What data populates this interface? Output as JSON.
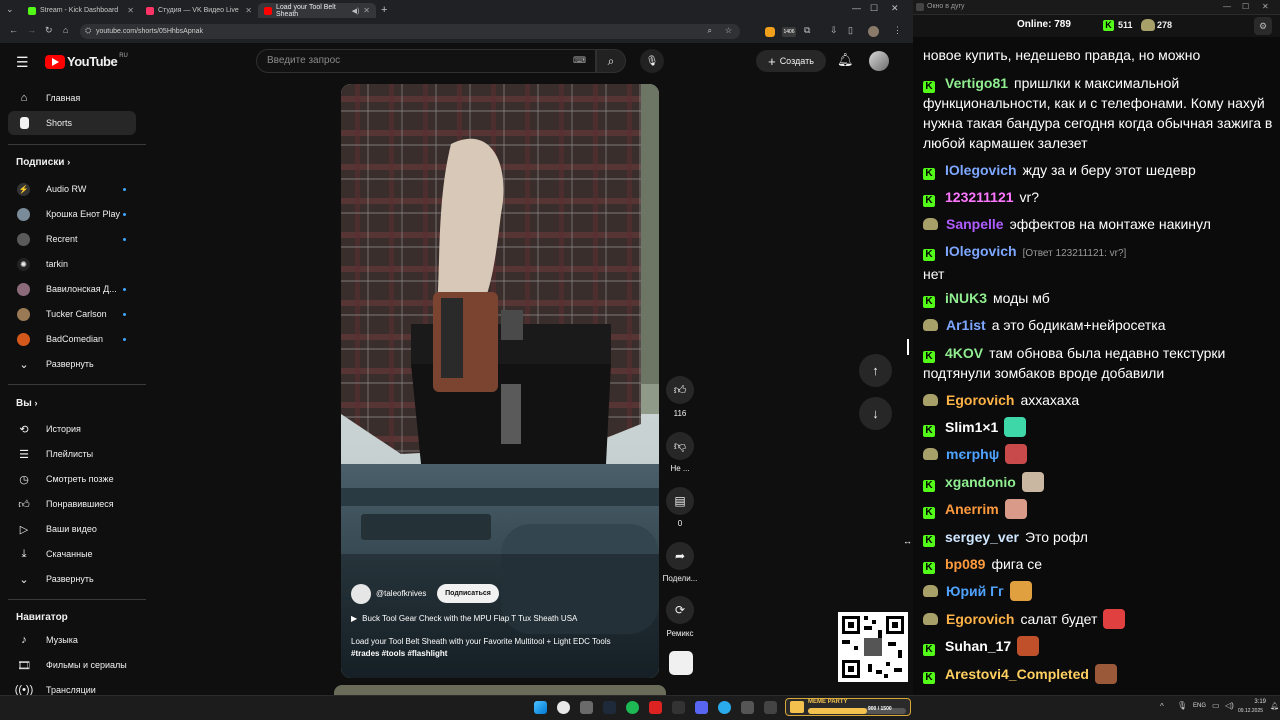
{
  "browser": {
    "tabs": [
      {
        "title": "Stream - Kick Dashboard",
        "color": "#53fc18"
      },
      {
        "title": "Студия — VK Видео Live",
        "color": "#ff3366"
      },
      {
        "title": "Load your Tool Belt Sheath",
        "color": "#ff0000"
      }
    ],
    "url": "youtube.com/shorts/05HhbsApnak"
  },
  "youtube": {
    "logo": "YouTube",
    "region": "RU",
    "search_placeholder": "Введите запрос",
    "create_label": "Создать",
    "nav": [
      {
        "label": "Главная",
        "icon": "home-icon"
      },
      {
        "label": "Shorts",
        "icon": "shorts-icon"
      }
    ],
    "subscriptions_title": "Подписки",
    "subscriptions": [
      {
        "label": "Audio RW",
        "color": "#444"
      },
      {
        "label": "Крошка Енот Play",
        "color": "#7a8b99"
      },
      {
        "label": "Recrent",
        "color": "#5a5a5a"
      },
      {
        "label": "tarkin",
        "color": "#333"
      },
      {
        "label": "Вавилонская Д...",
        "color": "#8b6a7a"
      },
      {
        "label": "Tucker Carlson",
        "color": "#9a7a55"
      },
      {
        "label": "BadComedian",
        "color": "#d4581c"
      }
    ],
    "expand_label": "Развернуть",
    "you_title": "Вы",
    "you_items": [
      {
        "label": "История",
        "icon": "history-icon"
      },
      {
        "label": "Плейлисты",
        "icon": "playlist-icon"
      },
      {
        "label": "Смотреть позже",
        "icon": "clock-icon"
      },
      {
        "label": "Понравившиеся",
        "icon": "thumb-up-icon"
      },
      {
        "label": "Ваши видео",
        "icon": "video-icon"
      },
      {
        "label": "Скачанные",
        "icon": "download-icon"
      }
    ],
    "expand_label2": "Развернуть",
    "navigator_title": "Навигатор",
    "navigator_items": [
      {
        "label": "Музыка",
        "icon": "music-icon"
      },
      {
        "label": "Фильмы и сериалы",
        "icon": "film-icon"
      },
      {
        "label": "Трансляции",
        "icon": "live-icon"
      }
    ],
    "short": {
      "channel": "@taleofknives",
      "subscribe_label": "Подписаться",
      "product_link": "Buck Tool Gear Check with the MPU Flap T Tux Sheath USA",
      "title": "Load your Tool Belt Sheath with your Favorite Multitool + Light EDC Tools",
      "hashtags": "#trades #tools #flashlight",
      "likes": "116",
      "dislike_label": "Не ...",
      "comments": "0",
      "share_label": "Подели...",
      "remix_label": "Ремикс"
    }
  },
  "chat": {
    "window_title": "Окно в дугу",
    "online_label": "Online:",
    "online_count": "789",
    "kick_count": "511",
    "other_count": "278",
    "top_partial": "новое купить, недешево правда, но можно",
    "messages": [
      {
        "badge": "kick",
        "nick": "Vertigo81",
        "color": "#90ee90",
        "text": "пришлки к максимальной функциональности, как и с телефонами. Кому нахуй нужна такая бандура сегодня когда обычная зажига в любой кармашек залезет"
      },
      {
        "badge": "kick",
        "nick": "IOlegovich",
        "color": "#7ea7ff",
        "text": "жду за и беру этот шедевр"
      },
      {
        "badge": "kick",
        "nick": "123211121",
        "color": "#ff77ff",
        "text": "vr?"
      },
      {
        "badge": "gold",
        "nick": "Sanpelle",
        "color": "#b05cff",
        "text": "эффектов на монтаже накинул"
      },
      {
        "badge": "kick",
        "nick": "IOlegovich",
        "color": "#7ea7ff",
        "reply": "[Ответ 123211121: vr?]",
        "text": "нет"
      },
      {
        "badge": "kick",
        "nick": "iNUK3",
        "color": "#90ee90",
        "text": "моды мб"
      },
      {
        "badge": "gold",
        "nick": "Ar1ist",
        "color": "#7ea7ff",
        "text": "а это бодикам+нейросетка"
      },
      {
        "badge": "kick",
        "nick": "4KOV",
        "color": "#90ee90",
        "text": "там обнова была недавно текстурки подтянули зомбаков вроде добавили"
      },
      {
        "badge": "gold",
        "nick": "Egorovich",
        "color": "#ffb347",
        "text": "аххахаха"
      },
      {
        "badge": "kick",
        "nick": "Slim1×1",
        "color": "#ffffff",
        "emote": "#3ed8a8"
      },
      {
        "badge": "gold",
        "nick": "mєrphψ",
        "color": "#4fa3ff",
        "emote": "#c84a4a"
      },
      {
        "badge": "kick",
        "nick": "xgandonio",
        "color": "#90ee90",
        "emote": "#c9b7a2"
      },
      {
        "badge": "kick",
        "nick": "Anerrim",
        "color": "#ff9a3d",
        "emote": "#d99a8a"
      },
      {
        "badge": "kick",
        "nick": "sergey_ver",
        "color": "#cfe6ff",
        "text": "Это рофл"
      },
      {
        "badge": "kick",
        "nick": "bp089",
        "color": "#ff9a3d",
        "text": "фига се"
      },
      {
        "badge": "gold",
        "nick": "Юрий Гг",
        "color": "#4fa3ff",
        "emote": "#e0a040"
      },
      {
        "badge": "gold",
        "nick": "Egorovich",
        "color": "#ffb347",
        "text": "салат будет",
        "emote": "#e04040"
      },
      {
        "badge": "kick",
        "nick": "Suhan_17",
        "color": "#ffffff",
        "emote": "#c0502a"
      },
      {
        "badge": "kick",
        "nick": "Arestovi4_Completed",
        "color": "#ffd060",
        "emote": "#9a5a3a"
      }
    ]
  },
  "taskbar": {
    "meme_label": "MEME PARTY",
    "meme_progress": "900 / 1500",
    "lang": "ENG",
    "time": "3:19",
    "date": "09.12.2025"
  }
}
